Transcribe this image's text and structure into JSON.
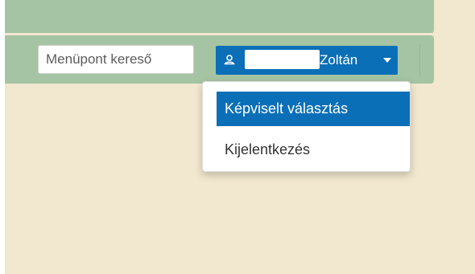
{
  "search": {
    "placeholder": "Menüpont kereső"
  },
  "user_menu": {
    "name": "Zoltán",
    "items": [
      {
        "label": "Képviselt választás",
        "active": true
      },
      {
        "label": "Kijelentkezés",
        "active": false
      }
    ]
  },
  "colors": {
    "page_background": "#f2e8cf",
    "nav_green": "#a5c4a3",
    "accent_blue": "#0a6fb7"
  },
  "icons": {
    "user": "user-icon",
    "caret": "chevron-down-icon"
  }
}
